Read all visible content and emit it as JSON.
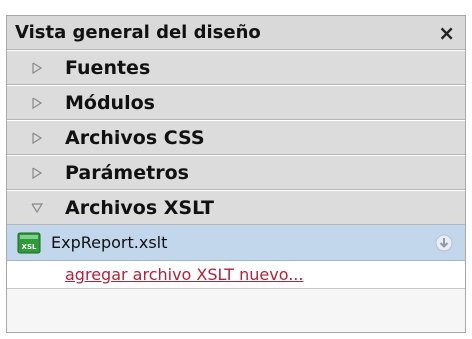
{
  "panel": {
    "title": "Vista general del diseño",
    "close_glyph": "×"
  },
  "sections": [
    {
      "label": "Fuentes",
      "expanded": false,
      "icon": "triangle-right-icon"
    },
    {
      "label": "Módulos",
      "expanded": false,
      "icon": "triangle-right-icon"
    },
    {
      "label": "Archivos CSS",
      "expanded": false,
      "icon": "triangle-right-icon"
    },
    {
      "label": "Parámetros",
      "expanded": false,
      "icon": "triangle-right-icon"
    },
    {
      "label": "Archivos XSLT",
      "expanded": true,
      "icon": "triangle-down-icon"
    }
  ],
  "xslt_files": [
    {
      "name": "ExpReport.xslt",
      "icon": "xslt-file-icon",
      "action_icon": "download-circle-icon"
    }
  ],
  "add_xslt_link": "agregar archivo XSLT nuevo...",
  "colors": {
    "title_bg": "#d9d9d9",
    "section_bg": "#dcdcdc",
    "selected_row_bg": "#c2d6ec",
    "link_color": "#b3213a",
    "xslt_icon_green": "#2e9a3a"
  }
}
